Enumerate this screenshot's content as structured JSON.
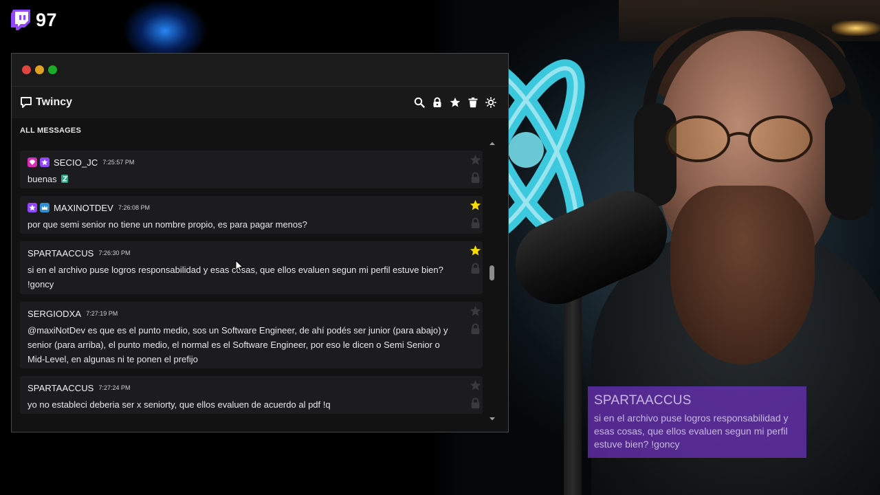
{
  "stream": {
    "viewer_count": "97",
    "highlight": {
      "author": "SPARTAACCUS",
      "text": "si en el archivo puse logros responsabilidad y esas cosas, que ellos evaluen segun mi perfil estuve bien? !goncy"
    }
  },
  "window": {
    "app_name": "Twincy",
    "toolbar": [
      "search-icon",
      "lock-icon",
      "star-icon",
      "trash-icon",
      "sun-icon"
    ],
    "section_label": "ALL MESSAGES"
  },
  "messages": [
    {
      "author": "SECIO_JC",
      "time": "7:25:57 PM",
      "text": "buenas",
      "badges": [
        "gem",
        "star"
      ],
      "starred": false
    },
    {
      "author": "MAXINOTDEV",
      "time": "7:26:08 PM",
      "text": "por que semi senior no tiene un nombre propio, es para pagar menos?",
      "badges": [
        "star",
        "crown"
      ],
      "starred": true
    },
    {
      "author": "SPARTAACCUS",
      "time": "7:26:30 PM",
      "text": "si en el archivo puse logros responsabilidad y esas cosas, que ellos evaluen segun mi perfil estuve bien? !goncy",
      "badges": [],
      "starred": true
    },
    {
      "author": "SERGIODXA",
      "time": "7:27:19 PM",
      "text": "@maxiNotDev es que es el punto medio, sos un Software Engineer, de ahí podés ser junior (para abajo) y senior (para arriba), el punto medio, el normal es el Software Engineer, por eso le dicen o Semi Senior o Mid-Level, en algunas ni te ponen el prefijo",
      "badges": [],
      "starred": false
    },
    {
      "author": "SPARTAACCUS",
      "time": "7:27:24 PM",
      "text": "yo no estableci deberia ser x seniorty, que ellos evaluen de acuerdo al pdf !q",
      "badges": [],
      "starred": false
    }
  ],
  "colors": {
    "accent_star": "#f5d90a",
    "twitch_purple": "#9146ff",
    "highlight_bg": "#6e32be"
  }
}
